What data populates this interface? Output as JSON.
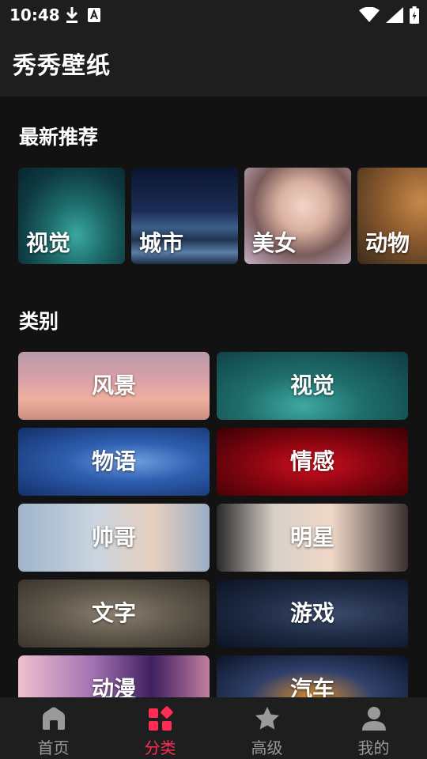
{
  "status": {
    "time": "10:48",
    "left_icons": [
      "download-icon",
      "font-icon"
    ],
    "right_icons": [
      "wifi-icon",
      "signal-icon",
      "battery-icon"
    ]
  },
  "app": {
    "title": "秀秀壁纸"
  },
  "recommend": {
    "title": "最新推荐",
    "items": [
      {
        "label": "视觉"
      },
      {
        "label": "城市"
      },
      {
        "label": "美女"
      },
      {
        "label": "动物"
      }
    ]
  },
  "categories": {
    "title": "类别",
    "items": [
      {
        "label": "风景"
      },
      {
        "label": "视觉"
      },
      {
        "label": "物语"
      },
      {
        "label": "情感"
      },
      {
        "label": "帅哥"
      },
      {
        "label": "明星"
      },
      {
        "label": "文字"
      },
      {
        "label": "游戏"
      },
      {
        "label": "动漫"
      },
      {
        "label": "汽车"
      }
    ]
  },
  "nav": {
    "items": [
      {
        "label": "首页",
        "icon": "home-icon",
        "active": false
      },
      {
        "label": "分类",
        "icon": "category-icon",
        "active": true
      },
      {
        "label": "高级",
        "icon": "star-icon",
        "active": false
      },
      {
        "label": "我的",
        "icon": "person-icon",
        "active": false
      }
    ]
  },
  "colors": {
    "accent": "#ff2d55",
    "background": "#121212",
    "bar": "#1e1e1e",
    "inactive": "#9a9a9a"
  }
}
